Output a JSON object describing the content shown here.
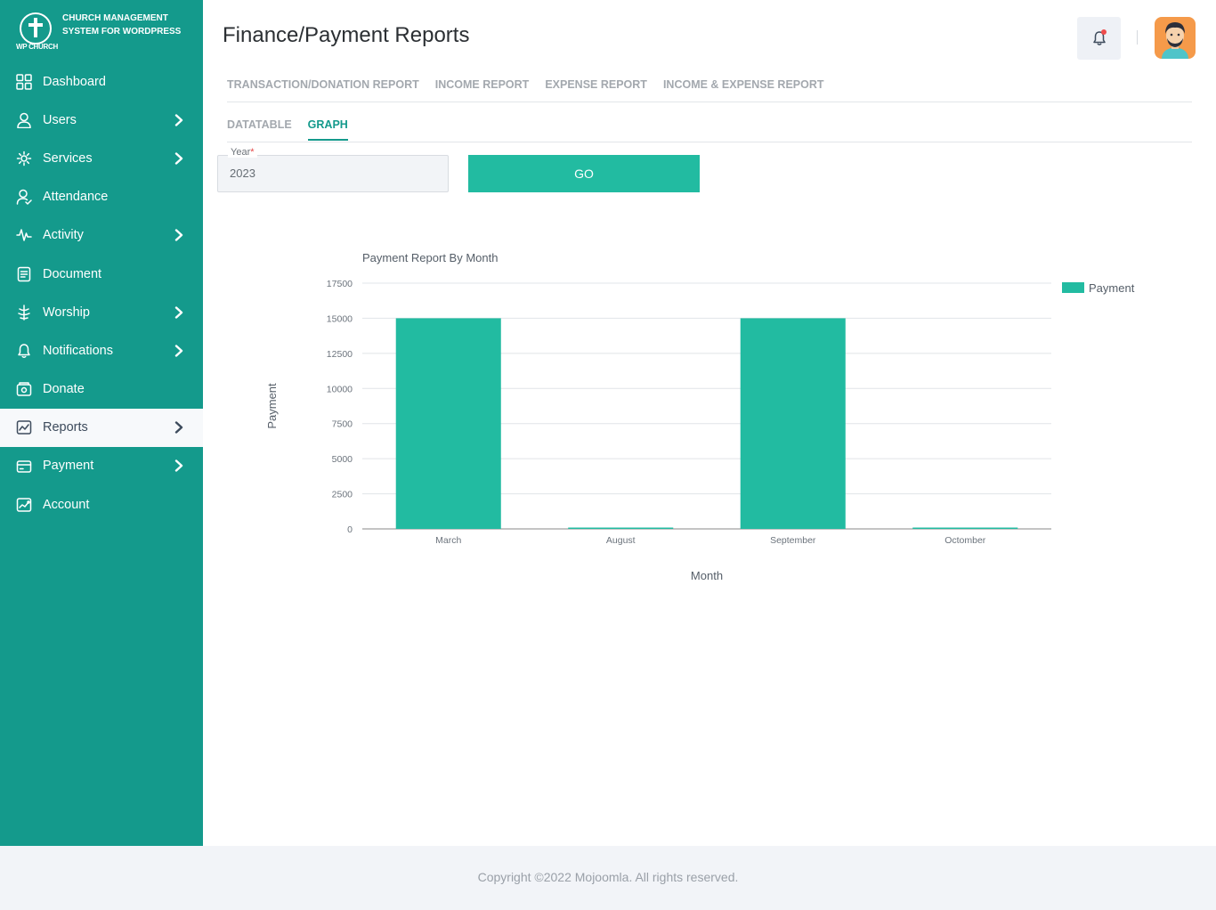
{
  "app": {
    "logo_sub": "WP CHURCH",
    "logo_text": "Church Management System for WordPress"
  },
  "sidebar": {
    "items": [
      {
        "label": "Dashboard",
        "icon": "dashboard-icon",
        "has_submenu": false,
        "active": false
      },
      {
        "label": "Users",
        "icon": "user-icon",
        "has_submenu": true,
        "active": false
      },
      {
        "label": "Services",
        "icon": "services-icon",
        "has_submenu": true,
        "active": false
      },
      {
        "label": "Attendance",
        "icon": "attendance-icon",
        "has_submenu": false,
        "active": false
      },
      {
        "label": "Activity",
        "icon": "activity-icon",
        "has_submenu": true,
        "active": false
      },
      {
        "label": "Document",
        "icon": "document-icon",
        "has_submenu": false,
        "active": false
      },
      {
        "label": "Worship",
        "icon": "worship-icon",
        "has_submenu": true,
        "active": false
      },
      {
        "label": "Notifications",
        "icon": "bell-icon",
        "has_submenu": true,
        "active": false
      },
      {
        "label": "Donate",
        "icon": "donate-icon",
        "has_submenu": false,
        "active": false
      },
      {
        "label": "Reports",
        "icon": "reports-icon",
        "has_submenu": true,
        "active": true
      },
      {
        "label": "Payment",
        "icon": "payment-icon",
        "has_submenu": true,
        "active": false
      },
      {
        "label": "Account",
        "icon": "account-icon",
        "has_submenu": false,
        "active": false
      }
    ]
  },
  "header": {
    "title": "Finance/Payment Reports"
  },
  "tabs": [
    "TRANSACTION/DONATION REPORT",
    "INCOME REPORT",
    "EXPENSE REPORT",
    "INCOME & EXPENSE REPORT"
  ],
  "subtabs": {
    "datatable": "DATATABLE",
    "graph": "GRAPH",
    "active": "GRAPH"
  },
  "filter": {
    "year_label": "Year",
    "year_required_mark": "*",
    "year_value": "2023",
    "go_label": "GO"
  },
  "chart_data": {
    "type": "bar",
    "title": "Payment Report By Month",
    "xlabel": "Month",
    "ylabel": "Payment",
    "categories": [
      "March",
      "August",
      "September",
      "Octomber"
    ],
    "series": [
      {
        "name": "Payment",
        "values": [
          15000,
          0,
          15000,
          0
        ],
        "color": "#22bba1"
      }
    ],
    "ylim": [
      0,
      17500
    ],
    "yticks": [
      0,
      2500,
      5000,
      7500,
      10000,
      12500,
      15000,
      17500
    ],
    "grid": true,
    "legend_position": "top-right"
  },
  "colors": {
    "sidebar": "#149a8c",
    "accent": "#22bba1",
    "footer_bg": "#f2f4f8"
  },
  "footer": {
    "copyright": "Copyright ©2022 Mojoomla. All rights reserved."
  }
}
